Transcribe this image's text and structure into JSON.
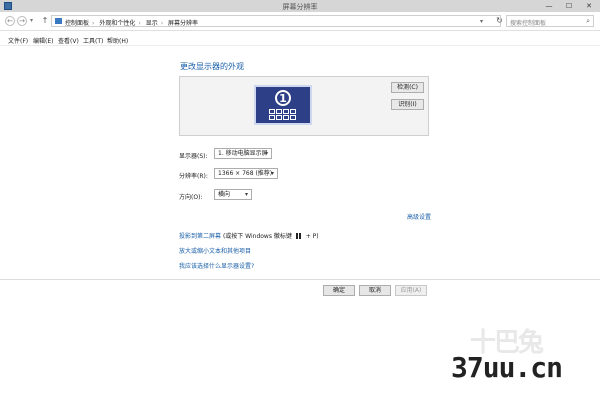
{
  "window": {
    "title": "屏幕分辨率",
    "minimize": "—",
    "maximize": "☐",
    "close": "✕"
  },
  "address": {
    "back": "←",
    "forward": "→",
    "dropdown": "▾",
    "up": "↑",
    "crumbs": [
      "控制面板",
      "外观和个性化",
      "显示",
      "屏幕分辨率"
    ],
    "history_dropdown": "▾",
    "refresh": "↻",
    "search_placeholder": "搜索控制面板"
  },
  "menu": [
    "文件(F)",
    "编辑(E)",
    "查看(V)",
    "工具(T)",
    "帮助(H)"
  ],
  "main": {
    "title": "更改显示器的外观",
    "monitor_number": "1",
    "detect_label": "检测(C)",
    "identify_label": "识别(I)",
    "display_label": "显示器(S):",
    "display_value": "1. 移动电脑显示屏",
    "resolution_label": "分辨率(R):",
    "resolution_value": "1366 × 768 (推荐)",
    "orientation_label": "方向(O):",
    "orientation_value": "横向",
    "advanced_link": "高级设置",
    "project_link": "投影到第二屏幕",
    "project_hint_a": "(或按下 Windows 徽标键",
    "project_hint_b": "+ P)",
    "text_size_link": "放大或缩小文本和其他项目",
    "which_setting_link": "我应该选择什么显示器设置?"
  },
  "footer": {
    "ok": "确定",
    "cancel": "取消",
    "apply": "应用(A)"
  },
  "watermark": {
    "logo": "十巴兔",
    "site": "37uu.cn"
  },
  "colors": {
    "accent": "#1a5fa8",
    "monitor": "#2d3f86"
  },
  "icons": {
    "app": "display-settings-icon",
    "control_panel": "control-panel-icon",
    "windows": "windows-logo-icon"
  }
}
